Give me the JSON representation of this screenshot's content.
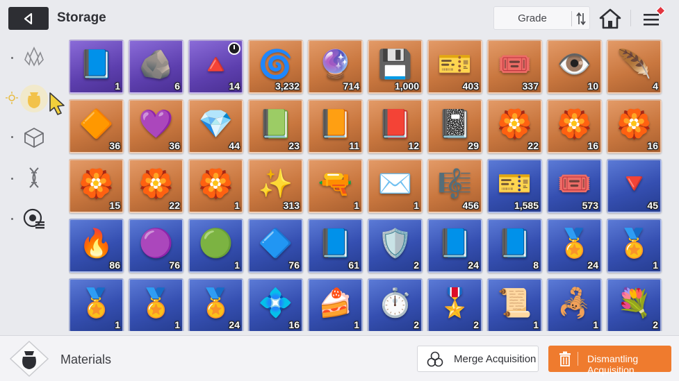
{
  "header": {
    "title": "Storage",
    "grade_label": "Grade"
  },
  "sidebar": {
    "tabs": [
      {
        "name": "crystal-tab",
        "icon": "crystal-icon",
        "active": false
      },
      {
        "name": "materials-tab",
        "icon": "pouch-icon",
        "active": true
      },
      {
        "name": "cube-tab",
        "icon": "cube-icon",
        "active": false
      },
      {
        "name": "dna-tab",
        "icon": "dna-icon",
        "active": false
      },
      {
        "name": "chip-tab",
        "icon": "chip-icon",
        "active": false
      }
    ]
  },
  "items": [
    {
      "grade": "purple",
      "icon": "📘",
      "qty": "1"
    },
    {
      "grade": "purple",
      "icon": "🪨",
      "qty": "6"
    },
    {
      "grade": "purple",
      "icon": "🔺",
      "qty": "14",
      "timer": true
    },
    {
      "grade": "orange",
      "icon": "🌀",
      "qty": "3,232"
    },
    {
      "grade": "orange",
      "icon": "🔮",
      "qty": "714"
    },
    {
      "grade": "orange",
      "icon": "💾",
      "qty": "1,000"
    },
    {
      "grade": "orange",
      "icon": "🎫",
      "qty": "403"
    },
    {
      "grade": "orange",
      "icon": "🎟️",
      "qty": "337"
    },
    {
      "grade": "orange",
      "icon": "👁️",
      "qty": "10"
    },
    {
      "grade": "orange",
      "icon": "🪶",
      "qty": "4"
    },
    {
      "grade": "orange",
      "icon": "🔶",
      "qty": "36"
    },
    {
      "grade": "orange",
      "icon": "💜",
      "qty": "36"
    },
    {
      "grade": "orange",
      "icon": "💎",
      "qty": "44"
    },
    {
      "grade": "orange",
      "icon": "📗",
      "qty": "23"
    },
    {
      "grade": "orange",
      "icon": "📙",
      "qty": "11"
    },
    {
      "grade": "orange",
      "icon": "📕",
      "qty": "12"
    },
    {
      "grade": "orange",
      "icon": "📓",
      "qty": "29"
    },
    {
      "grade": "orange",
      "icon": "🏵️",
      "qty": "22"
    },
    {
      "grade": "orange",
      "icon": "🏵️",
      "qty": "16"
    },
    {
      "grade": "orange",
      "icon": "🏵️",
      "qty": "16"
    },
    {
      "grade": "orange",
      "icon": "🏵️",
      "qty": "15"
    },
    {
      "grade": "orange",
      "icon": "🏵️",
      "qty": "22"
    },
    {
      "grade": "orange",
      "icon": "🏵️",
      "qty": "1"
    },
    {
      "grade": "orange",
      "icon": "✨",
      "qty": "313"
    },
    {
      "grade": "orange",
      "icon": "🔫",
      "qty": "1"
    },
    {
      "grade": "orange",
      "icon": "✉️",
      "qty": "1"
    },
    {
      "grade": "orange",
      "icon": "🎼",
      "qty": "456"
    },
    {
      "grade": "blue",
      "icon": "🎫",
      "qty": "1,585"
    },
    {
      "grade": "blue",
      "icon": "🎟️",
      "qty": "573"
    },
    {
      "grade": "blue",
      "icon": "🔻",
      "qty": "45"
    },
    {
      "grade": "blue",
      "icon": "🔥",
      "qty": "86"
    },
    {
      "grade": "blue",
      "icon": "🟣",
      "qty": "76"
    },
    {
      "grade": "blue",
      "icon": "🟢",
      "qty": "1"
    },
    {
      "grade": "blue",
      "icon": "🔷",
      "qty": "76"
    },
    {
      "grade": "blue",
      "icon": "📘",
      "qty": "61"
    },
    {
      "grade": "blue",
      "icon": "🛡️",
      "qty": "2"
    },
    {
      "grade": "blue",
      "icon": "📘",
      "qty": "24"
    },
    {
      "grade": "blue",
      "icon": "📘",
      "qty": "8"
    },
    {
      "grade": "blue",
      "icon": "🏅",
      "qty": "24"
    },
    {
      "grade": "blue",
      "icon": "🏅",
      "qty": "1"
    },
    {
      "grade": "blue",
      "icon": "🏅",
      "qty": "1"
    },
    {
      "grade": "blue",
      "icon": "🏅",
      "qty": "1"
    },
    {
      "grade": "blue",
      "icon": "🏅",
      "qty": "24"
    },
    {
      "grade": "blue",
      "icon": "💠",
      "qty": "16"
    },
    {
      "grade": "blue",
      "icon": "🍰",
      "qty": "1"
    },
    {
      "grade": "blue",
      "icon": "⏱️",
      "qty": "2"
    },
    {
      "grade": "blue",
      "icon": "🎖️",
      "qty": "2"
    },
    {
      "grade": "blue",
      "icon": "📜",
      "qty": "1"
    },
    {
      "grade": "blue",
      "icon": "🦂",
      "qty": "1"
    },
    {
      "grade": "blue",
      "icon": "💐",
      "qty": "2"
    }
  ],
  "footer": {
    "category_label": "Materials",
    "merge_label": "Merge Acquisition",
    "dismantle_label": "Dismantling Acquisition"
  },
  "colors": {
    "dismantle_accent": "#ef7b2e",
    "header_dark": "#2d2e33",
    "notify_red": "#e2353f"
  }
}
